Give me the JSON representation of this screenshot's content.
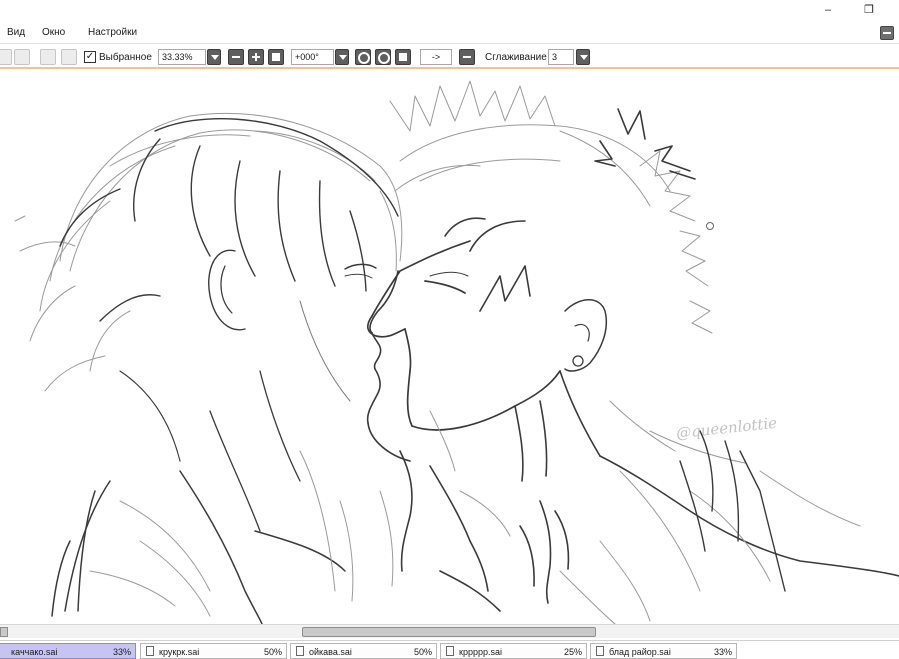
{
  "menu": {
    "items": [
      "Вид",
      "Окно",
      "Настройки"
    ]
  },
  "toolbar": {
    "selection_label": "Выбранное",
    "selection_checked": true,
    "zoom_value": "33.33%",
    "rotation_value": "+000°",
    "flip_value": "->",
    "smoothing_label": "Сглаживание",
    "smoothing_value": "3"
  },
  "canvas": {
    "watermark": "@queenlottie"
  },
  "tabs": [
    {
      "name": "каччако.sai",
      "zoom": "33%",
      "active": true
    },
    {
      "name": "крукрк.sai",
      "zoom": "50%",
      "active": false
    },
    {
      "name": "ойкава.sai",
      "zoom": "50%",
      "active": false
    },
    {
      "name": "кррррр.sai",
      "zoom": "25%",
      "active": false
    },
    {
      "name": "блад райор.sai",
      "zoom": "33%",
      "active": false
    }
  ],
  "colors": {
    "toolbar_underline": "#f2c489",
    "active_tab": "#c7c4f2",
    "sketch_line": "#3a3a3a"
  }
}
